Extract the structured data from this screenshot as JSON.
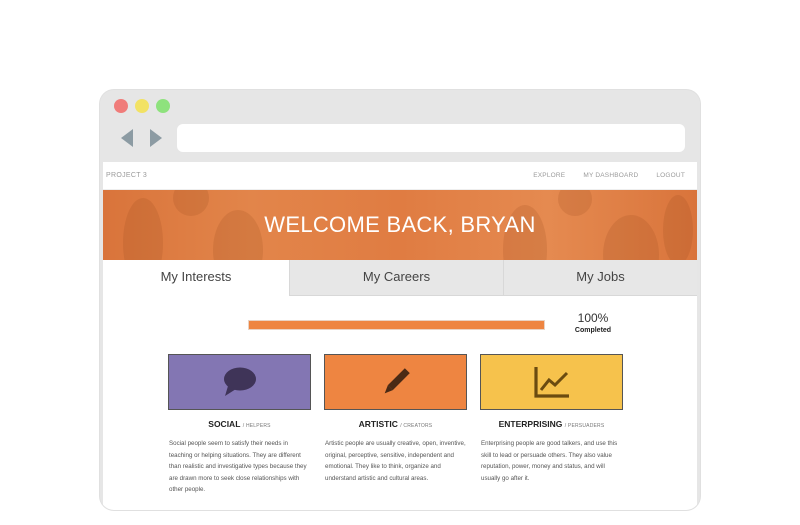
{
  "browser": {
    "address_value": "",
    "dot_colors": {
      "close": "#f07c7a",
      "minimize": "#f2e264",
      "zoom": "#8ee27d"
    }
  },
  "site": {
    "brand": "PROJECT 3",
    "nav": [
      "EXPLORE",
      "MY DASHBOARD",
      "LOGOUT"
    ]
  },
  "hero": {
    "title": "WELCOME BACK, BRYAN",
    "color": "#e07c42"
  },
  "tabs": [
    {
      "label": "My Interests",
      "active": true
    },
    {
      "label": "My Careers",
      "active": false
    },
    {
      "label": "My Jobs",
      "active": false
    }
  ],
  "progress": {
    "value": 1.0,
    "percent_label": "100%",
    "label": "Completed",
    "color": "#ee8541"
  },
  "cards": [
    {
      "title": "SOCIAL",
      "subtitle": "/ HELPERS",
      "icon": "speech-bubble-icon",
      "color": "#8376b3",
      "description": "Social people seem to satisfy their needs in teaching or helping situations. They are different than realistic and investigative types because they are drawn more to seek close relationships with other people."
    },
    {
      "title": "ARTISTIC",
      "subtitle": "/ CREATORS",
      "icon": "pencil-icon",
      "color": "#ee8541",
      "description": "Artistic people are usually creative, open, inventive, original, perceptive, sensitive, independent and emotional. They like to think, organize and understand artistic and cultural areas."
    },
    {
      "title": "ENTERPRISING",
      "subtitle": "/ PERSUADERS",
      "icon": "line-chart-icon",
      "color": "#f6c24c",
      "description": "Enterprising people are good talkers, and use this skill to lead or persuade others. They also value reputation, power, money and status, and will usually go after it."
    }
  ]
}
